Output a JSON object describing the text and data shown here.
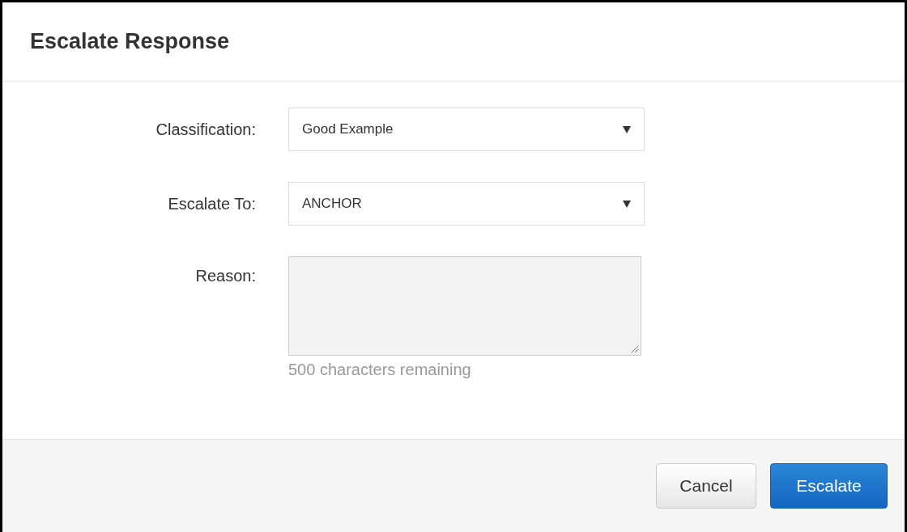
{
  "dialog": {
    "title": "Escalate Response"
  },
  "fields": [
    {
      "kind": "select",
      "label": "Classification:",
      "value": "Good Example"
    },
    {
      "kind": "select",
      "label": "Escalate To:",
      "value": "ANCHOR"
    },
    {
      "kind": "textarea",
      "label": "Reason:",
      "helper": "500 characters remaining"
    }
  ],
  "buttons": [
    {
      "label": "Cancel",
      "primary": false
    },
    {
      "label": "Escalate",
      "primary": true
    }
  ]
}
